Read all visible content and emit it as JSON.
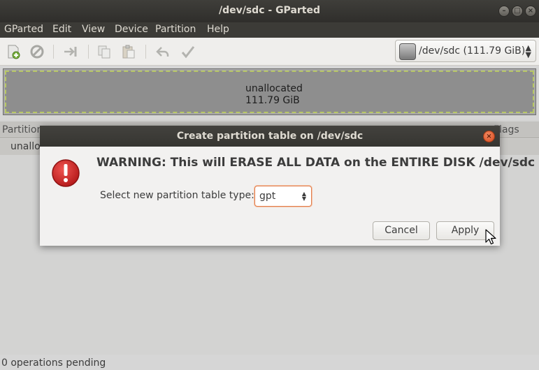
{
  "window": {
    "title": "/dev/sdc - GParted",
    "buttons": [
      "minimize",
      "maximize",
      "close"
    ]
  },
  "menu": [
    "GParted",
    "Edit",
    "View",
    "Device",
    "Partition",
    "Help"
  ],
  "toolbar": {
    "icons": [
      "new-partition-icon",
      "delete-icon",
      "resize-move-icon",
      "copy-icon",
      "paste-icon",
      "undo-icon",
      "apply-icon"
    ],
    "device_selector": "/dev/sdc  (111.79 GiB)"
  },
  "disk_map": {
    "label": "unallocated",
    "size": "111.79 GiB"
  },
  "partition_list": {
    "headers": [
      "Partition",
      "Flags"
    ],
    "rows": [
      {
        "partition": "unalloc"
      }
    ]
  },
  "status": "0 operations pending",
  "dialog": {
    "title": "Create partition table on /dev/sdc",
    "warning": "WARNING:  This will ERASE ALL DATA on the ENTIRE DISK /dev/sdc",
    "select_label": "Select new partition table type:",
    "selected_type": "gpt",
    "cancel_label": "Cancel",
    "apply_label": "Apply"
  },
  "colors": {
    "titlebar": "#3c3b37",
    "close_button": "#e05a2b",
    "focus_border": "#e07f4f",
    "warning_icon": "#c7162b"
  }
}
